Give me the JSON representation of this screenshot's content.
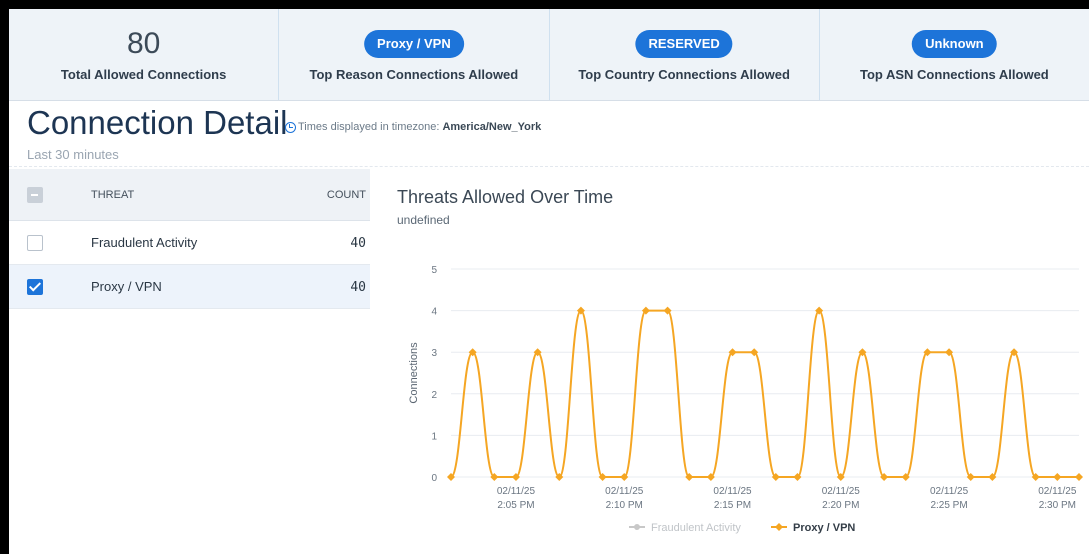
{
  "stats": [
    {
      "value": "80",
      "caption": "Total Allowed Connections"
    },
    {
      "pill": "Proxy / VPN",
      "caption": "Top Reason Connections Allowed"
    },
    {
      "pill": "RESERVED",
      "caption": "Top Country Connections Allowed"
    },
    {
      "pill": "Unknown",
      "caption": "Top ASN Connections Allowed"
    }
  ],
  "header": {
    "title": "Connection Detail",
    "tz_label": "Times displayed in timezone:",
    "tz_value": "America/New_York",
    "range": "Last 30 minutes"
  },
  "table": {
    "col_threat": "THREAT",
    "col_count": "COUNT",
    "rows": [
      {
        "name": "Fraudulent Activity",
        "count": "40",
        "checked": false
      },
      {
        "name": "Proxy / VPN",
        "count": "40",
        "checked": true
      }
    ]
  },
  "colors": {
    "accent": "#1d74d9",
    "series_proxy": "#f5a623",
    "series_fraud": "#c8c8c8"
  },
  "icons": {
    "timezone": "clock-icon"
  },
  "chart_data": {
    "type": "line",
    "title": "Threats Allowed Over Time",
    "subtitle": "undefined",
    "ylabel": "Connections",
    "ylim": [
      0,
      5
    ],
    "yticks": [
      "0",
      "1",
      "2",
      "3",
      "4",
      "5"
    ],
    "xtick_labels": [
      [
        "02/11/25",
        "2:05 PM"
      ],
      [
        "02/11/25",
        "2:10 PM"
      ],
      [
        "02/11/25",
        "2:15 PM"
      ],
      [
        "02/11/25",
        "2:20 PM"
      ],
      [
        "02/11/25",
        "2:25 PM"
      ],
      [
        "02/11/25",
        "2:30 PM"
      ]
    ],
    "xtick_index": [
      3,
      8,
      13,
      18,
      23,
      28
    ],
    "legend": "bottom",
    "series": [
      {
        "name": "Fraudulent Activity",
        "visible": false,
        "values": []
      },
      {
        "name": "Proxy / VPN",
        "visible": true,
        "values": [
          0,
          3,
          0,
          0,
          3,
          0,
          4,
          0,
          0,
          4,
          4,
          0,
          0,
          3,
          3,
          0,
          0,
          4,
          0,
          3,
          0,
          0,
          3,
          3,
          0,
          0,
          3,
          0,
          0,
          0
        ]
      }
    ]
  }
}
